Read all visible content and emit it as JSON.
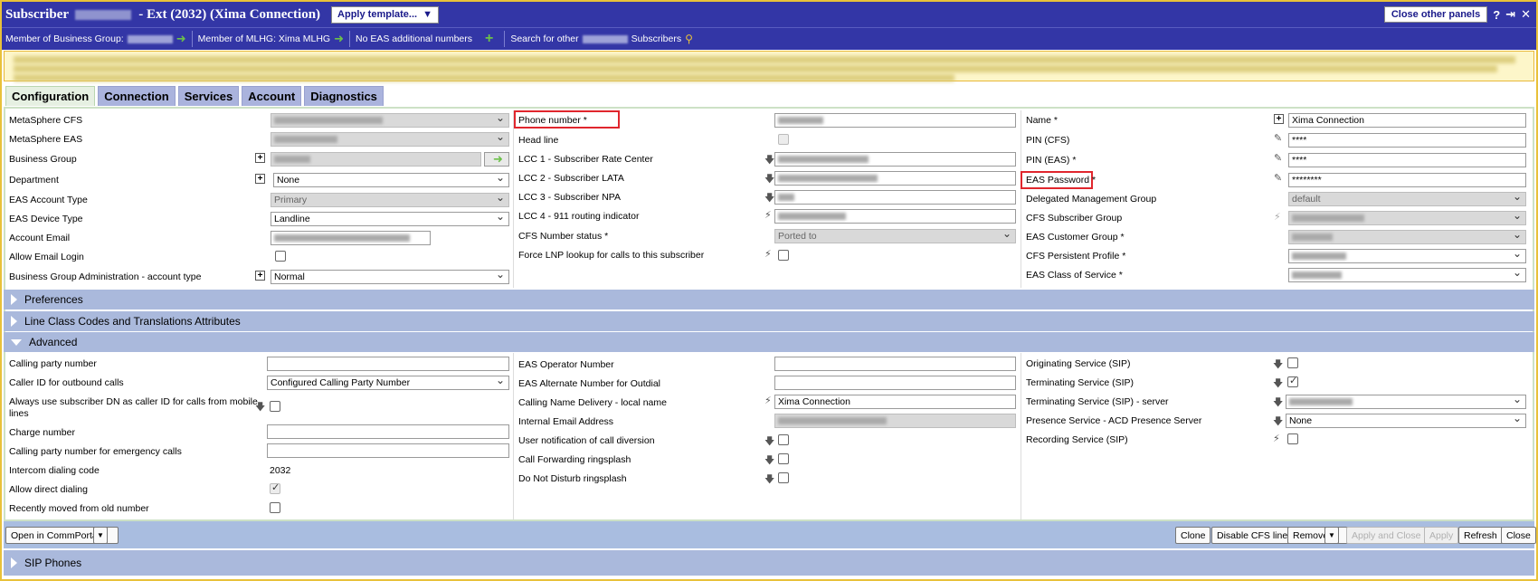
{
  "title": {
    "prefix": "Subscriber",
    "suffix": "- Ext (2032) (Xima Connection)",
    "apply_template": "Apply template...",
    "close_panels": "Close other panels"
  },
  "infobar": {
    "business_group": "Member of Business Group:",
    "mlhg": "Member of MLHG: Xima MLHG",
    "eas": "No EAS additional numbers",
    "search_prefix": "Search for other",
    "search_suffix": "Subscribers"
  },
  "tabs": [
    "Configuration",
    "Connection",
    "Services",
    "Account",
    "Diagnostics"
  ],
  "config": {
    "col1": [
      {
        "label": "MetaSphere CFS"
      },
      {
        "label": "MetaSphere EAS"
      },
      {
        "label": "Business Group"
      },
      {
        "label": "Department",
        "value": "None"
      },
      {
        "label": "EAS Account Type",
        "value": "Primary"
      },
      {
        "label": "EAS Device Type",
        "value": "Landline"
      },
      {
        "label": "Account Email"
      },
      {
        "label": "Allow Email Login"
      },
      {
        "label": "Business Group Administration - account type",
        "value": "Normal"
      }
    ],
    "col2": [
      {
        "label": "Phone number *"
      },
      {
        "label": "Head line"
      },
      {
        "label": "LCC 1 - Subscriber Rate Center"
      },
      {
        "label": "LCC 2 - Subscriber LATA"
      },
      {
        "label": "LCC 3 - Subscriber NPA"
      },
      {
        "label": "LCC 4 - 911 routing indicator"
      },
      {
        "label": "CFS Number status *",
        "value": "Ported to"
      },
      {
        "label": "Force LNP lookup for calls to this subscriber"
      }
    ],
    "col3": [
      {
        "label": "Name *",
        "value": "Xima Connection"
      },
      {
        "label": "PIN (CFS)",
        "value": "****"
      },
      {
        "label": "PIN (EAS) *",
        "value": "****"
      },
      {
        "label": "EAS Password *",
        "value": "********"
      },
      {
        "label": "Delegated Management Group",
        "value": "default"
      },
      {
        "label": "CFS Subscriber Group"
      },
      {
        "label": "EAS Customer Group *"
      },
      {
        "label": "CFS Persistent Profile *"
      },
      {
        "label": "EAS Class of Service *"
      }
    ]
  },
  "sections": {
    "preferences": "Preferences",
    "lcc": "Line Class Codes and Translations Attributes",
    "advanced": "Advanced",
    "sip": "SIP Phones"
  },
  "advanced": {
    "col1": [
      {
        "label": "Calling party number"
      },
      {
        "label": "Caller ID for outbound calls",
        "value": "Configured Calling Party Number"
      },
      {
        "label": "Always use subscriber DN as caller ID for calls from mobile"
      },
      {
        "label": "lines"
      },
      {
        "label": "Charge number"
      },
      {
        "label": "Calling party number for emergency calls"
      },
      {
        "label": "Intercom dialing code",
        "value": "2032"
      },
      {
        "label": "Allow direct dialing"
      },
      {
        "label": "Recently moved from old number"
      }
    ],
    "col2": [
      {
        "label": "EAS Operator Number"
      },
      {
        "label": "EAS Alternate Number for Outdial"
      },
      {
        "label": "Calling Name Delivery - local name",
        "value": "Xima Connection"
      },
      {
        "label": "Internal Email Address"
      },
      {
        "label": "User notification of call diversion"
      },
      {
        "label": "Call Forwarding ringsplash"
      },
      {
        "label": "Do Not Disturb ringsplash"
      }
    ],
    "col3": [
      {
        "label": "Originating Service (SIP)"
      },
      {
        "label": "Terminating Service (SIP)"
      },
      {
        "label": "Terminating Service (SIP) - server"
      },
      {
        "label": "Presence Service - ACD Presence Server",
        "value": "None"
      },
      {
        "label": "Recording Service (SIP)"
      }
    ]
  },
  "bottom": {
    "open": "Open in CommPortal",
    "clone": "Clone",
    "disable": "Disable CFS line",
    "remove": "Remove",
    "apply_close": "Apply and Close",
    "apply": "Apply",
    "refresh": "Refresh",
    "close": "Close"
  }
}
